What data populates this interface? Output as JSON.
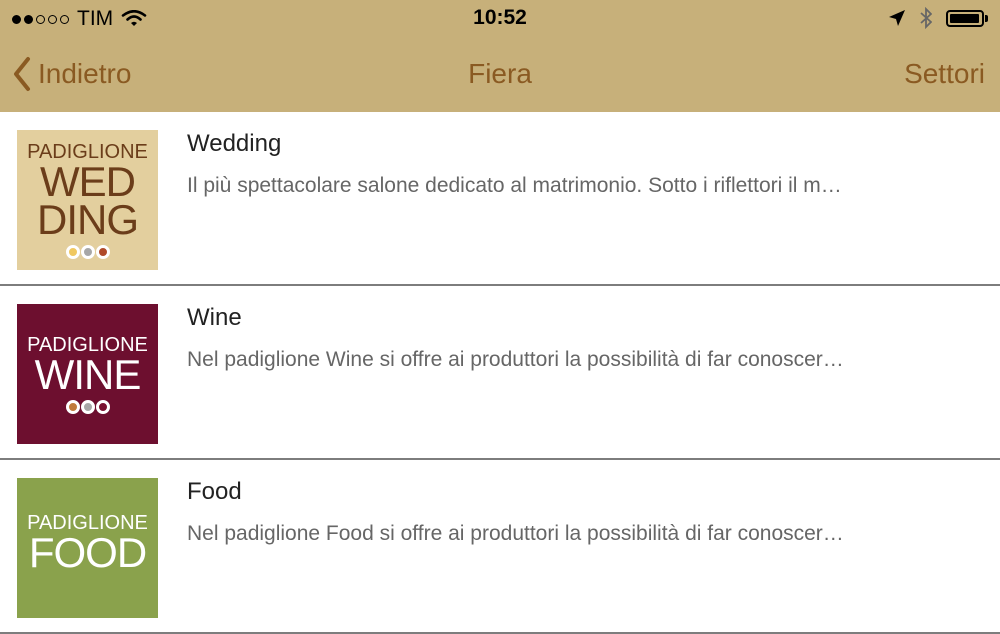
{
  "status_bar": {
    "signal_dots_filled": 2,
    "signal_dots_total": 5,
    "carrier": "TIM",
    "time": "10:52",
    "battery_level": 0.95
  },
  "nav": {
    "back_label": "Indietro",
    "title": "Fiera",
    "right_action": "Settori"
  },
  "items": [
    {
      "name": "Wedding",
      "description": "Il più spettacolare salone dedicato al matrimonio. Sotto i riflettori il m…",
      "logo": {
        "small": "PADIGLIONE",
        "big_line1": "WED",
        "big_line2": "DING",
        "bg": "#e3cf9e",
        "fg": "#6b3d1a",
        "dot_colors": [
          "#f0c860",
          "#a7a7a7",
          "#b04a2a"
        ]
      }
    },
    {
      "name": "Wine",
      "description": "Nel padiglione Wine si offre ai produttori la possibilità di far conoscer…",
      "logo": {
        "small": "PADIGLIONE",
        "big_line1": "WINE",
        "big_line2": "",
        "bg": "#6d0f2f",
        "fg": "#ffffff",
        "dot_colors": [
          "#c07a3a",
          "#a7a7a7",
          "#7a1030"
        ]
      }
    },
    {
      "name": "Food",
      "description": "Nel padiglione Food si offre ai produttori la possibilità di far conoscer…",
      "logo": {
        "small": "PADIGLIONE",
        "big_line1": "FOOD",
        "big_line2": "",
        "bg": "#8aa24c",
        "fg": "#ffffff",
        "dot_colors": []
      }
    }
  ],
  "colors": {
    "bar_bg": "#c7b07a",
    "nav_text": "#8a5a22",
    "separator": "#7d7d7d"
  }
}
